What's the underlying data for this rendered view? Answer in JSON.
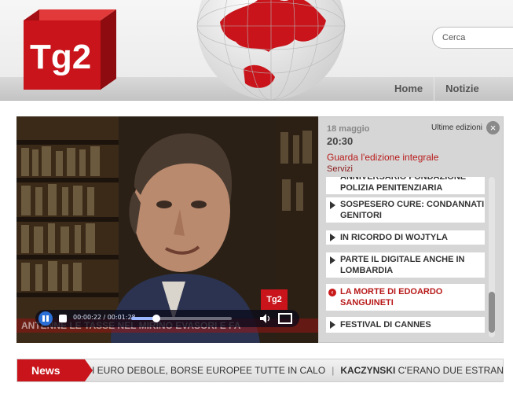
{
  "header": {
    "logo_text": "Tg2",
    "search_placeholder": "Cerca",
    "nav": [
      "Home",
      "Notizie"
    ]
  },
  "player": {
    "crawl_text": "ANTENNE LE TASSE NEL MIRINO EVASORI E FA",
    "time_current": "00:00:22",
    "time_total": "00:01:28",
    "time_display": "00:00:22 / 00:01:28",
    "progress": 0.25,
    "bug_text": "Tg2"
  },
  "side": {
    "date": "18 maggio",
    "time": "20:30",
    "ultime_label": "Ultime edizioni",
    "guarda_label": "Guarda l'edizione integrale",
    "servizi_label": "Servizi",
    "items": [
      {
        "label": "ANNIVERSARIO FONDAZIONE POLIZIA PENITENZIARIA",
        "active": false
      },
      {
        "label": "SOSPESERO CURE: CONDANNATI GENITORI",
        "active": false
      },
      {
        "label": "IN RICORDO DI WOJTYLA",
        "active": false
      },
      {
        "label": "PARTE IL DIGITALE ANCHE IN LOMBARDIA",
        "active": false
      },
      {
        "label": "LA MORTE DI EDOARDO SANGUINETI",
        "active": true
      },
      {
        "label": "FESTIVAL DI CANNES",
        "active": false
      }
    ]
  },
  "news": {
    "label": "News",
    "ticker": [
      {
        "head": "I EURO DEBOLE, BORSE EUROPEE TUTTE IN CALO",
        "bold": false
      },
      {
        "head": "KACZYNSKI",
        "bold": true,
        "rest": "C'ERANO DUE ESTRAN"
      }
    ]
  },
  "colors": {
    "brand_red": "#c8141a",
    "accent_red_text": "#b81a1a",
    "player_button_blue": "#2a6fd6"
  }
}
